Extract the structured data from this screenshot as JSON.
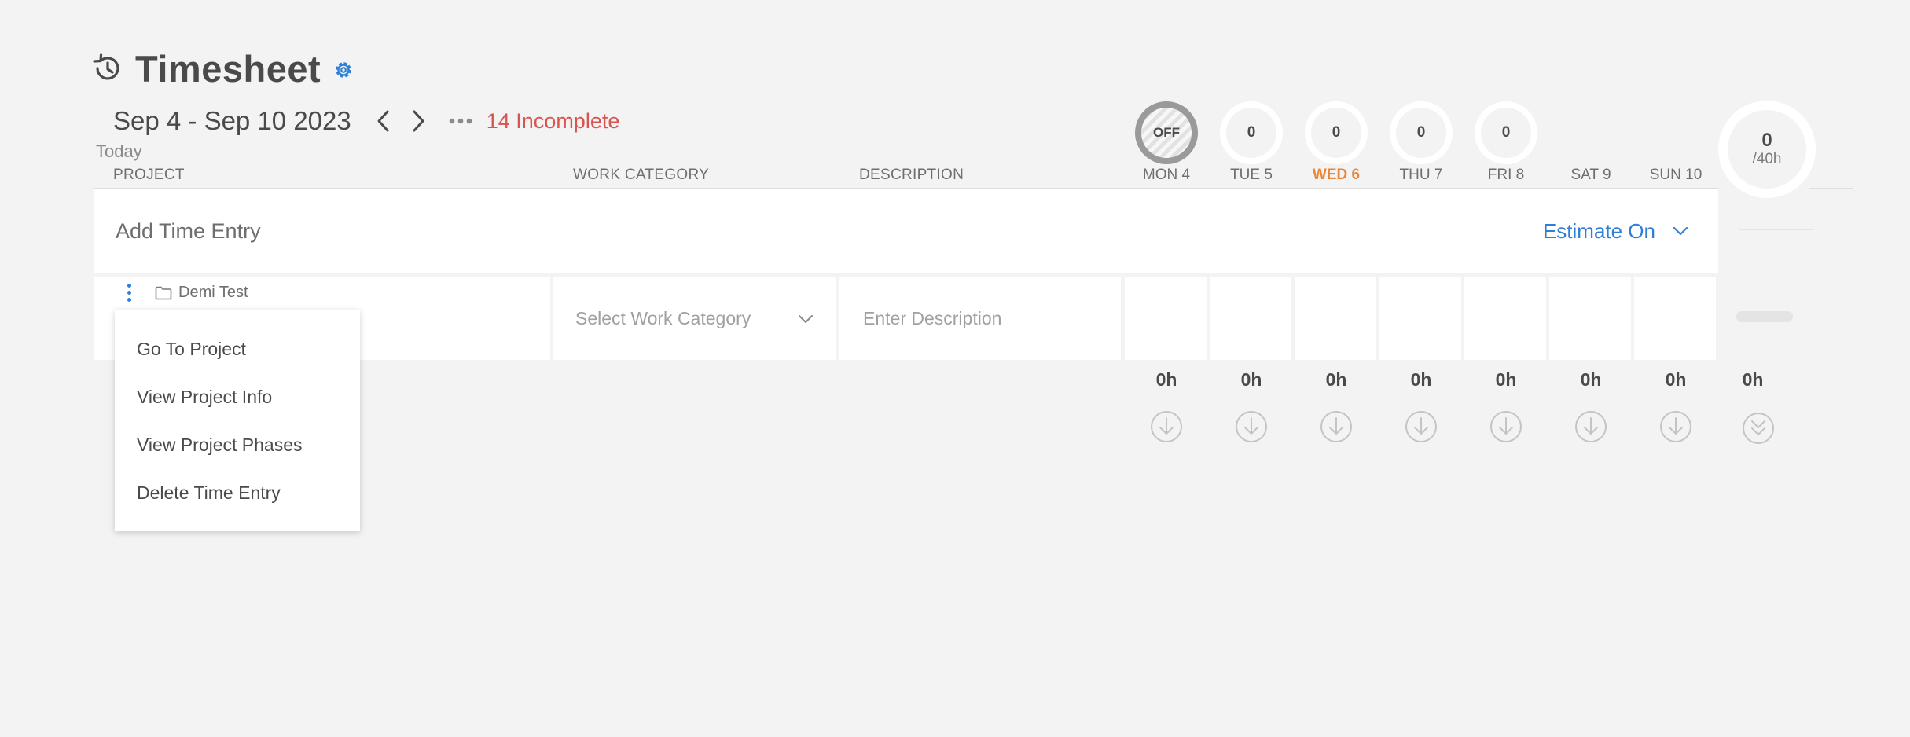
{
  "header": {
    "title": "Timesheet",
    "history_icon": "history-icon",
    "settings_icon": "gear-icon"
  },
  "date_nav": {
    "range": "Sep 4 - Sep 10 2023",
    "prev_icon": "chevron-left-icon",
    "next_icon": "chevron-right-icon",
    "more_icon": "more-horizontal-icon",
    "incomplete": "14 Incomplete",
    "today": "Today"
  },
  "columns": {
    "project": "PROJECT",
    "work_category": "WORK CATEGORY",
    "description": "DESCRIPTION"
  },
  "days": [
    {
      "label": "MON 4",
      "circle": "OFF",
      "total": "0h",
      "is_today": false,
      "off": true
    },
    {
      "label": "TUE 5",
      "circle": "0",
      "total": "0h",
      "is_today": false,
      "off": false
    },
    {
      "label": "WED 6",
      "circle": "0",
      "total": "0h",
      "is_today": true,
      "off": false
    },
    {
      "label": "THU 7",
      "circle": "0",
      "total": "0h",
      "is_today": false,
      "off": false
    },
    {
      "label": "FRI 8",
      "circle": "0",
      "total": "0h",
      "is_today": false,
      "off": false
    },
    {
      "label": "SAT 9",
      "circle": "",
      "total": "0h",
      "is_today": false,
      "off": false
    },
    {
      "label": "SUN 10",
      "circle": "",
      "total": "0h",
      "is_today": false,
      "off": false
    }
  ],
  "week_total": {
    "value": "0",
    "target": "/40h",
    "total": "0h"
  },
  "add_entry": {
    "label": "Add Time Entry",
    "estimate_label": "Estimate On",
    "estimate_icon": "chevron-down-icon"
  },
  "entry": {
    "project": "Demi Test",
    "project_icon": "folder-icon",
    "menu_icon": "kebab-menu-icon",
    "work_category_placeholder": "Select Work Category",
    "description_placeholder": "Enter Description"
  },
  "context_menu": {
    "items": [
      "Go To Project",
      "View Project Info",
      "View Project Phases",
      "Delete Time Entry"
    ]
  },
  "colors": {
    "accent": "#2f7fd6",
    "incomplete": "#d9534f",
    "today": "#e8873a",
    "background": "#f3f3f3"
  }
}
